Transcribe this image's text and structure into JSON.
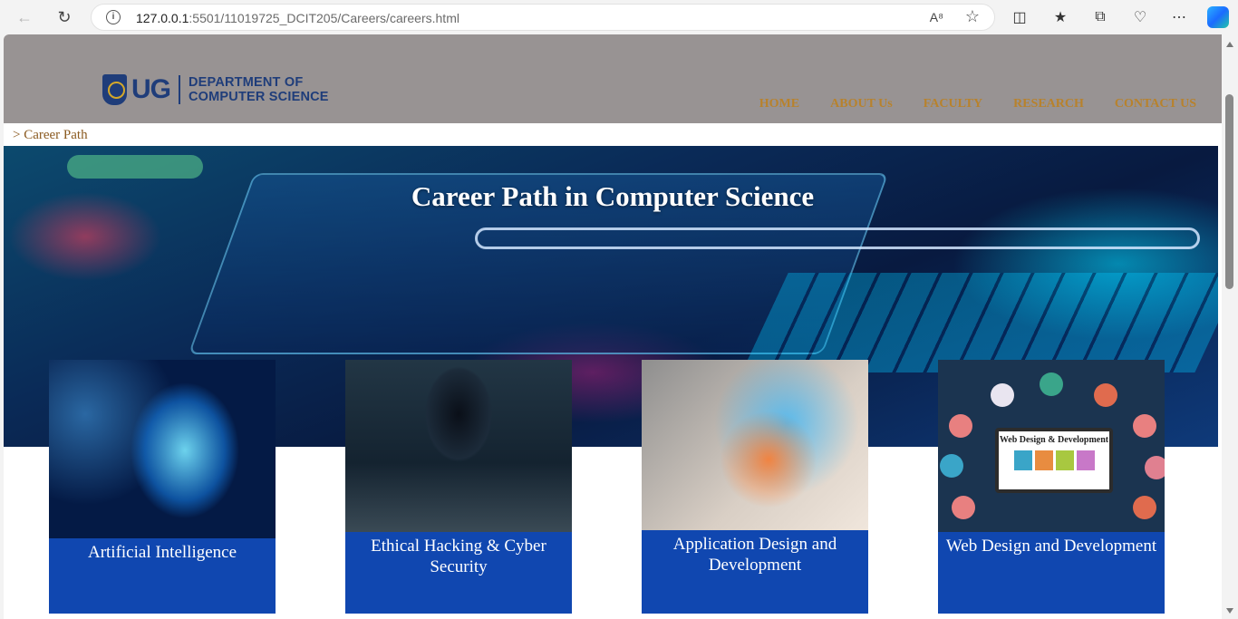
{
  "browser": {
    "url_host": "127.0.0.1",
    "url_rest": ":5501/11019725_DCIT205/Careers/careers.html"
  },
  "header": {
    "logo_ug": "UG",
    "logo_line1": "DEPARTMENT OF",
    "logo_line2": "COMPUTER SCIENCE",
    "nav": [
      "HOME",
      "ABOUT Us",
      "FACULTY",
      "RESEARCH",
      "CONTACT US"
    ]
  },
  "breadcrumb": "> Career Path",
  "hero": {
    "title": "Career Path in Computer Science"
  },
  "cards": [
    {
      "label": "Artificial Intelligence"
    },
    {
      "label": "Ethical Hacking & Cyber Security"
    },
    {
      "label": "Application Design and Development"
    },
    {
      "label": "Web Design and Development",
      "image_text": "Web Design & Development"
    }
  ],
  "colors": {
    "header_bg": "#989393",
    "nav_text": "#b8822c",
    "card_bg": "#1047b0",
    "brand_blue": "#1f3d7a"
  }
}
